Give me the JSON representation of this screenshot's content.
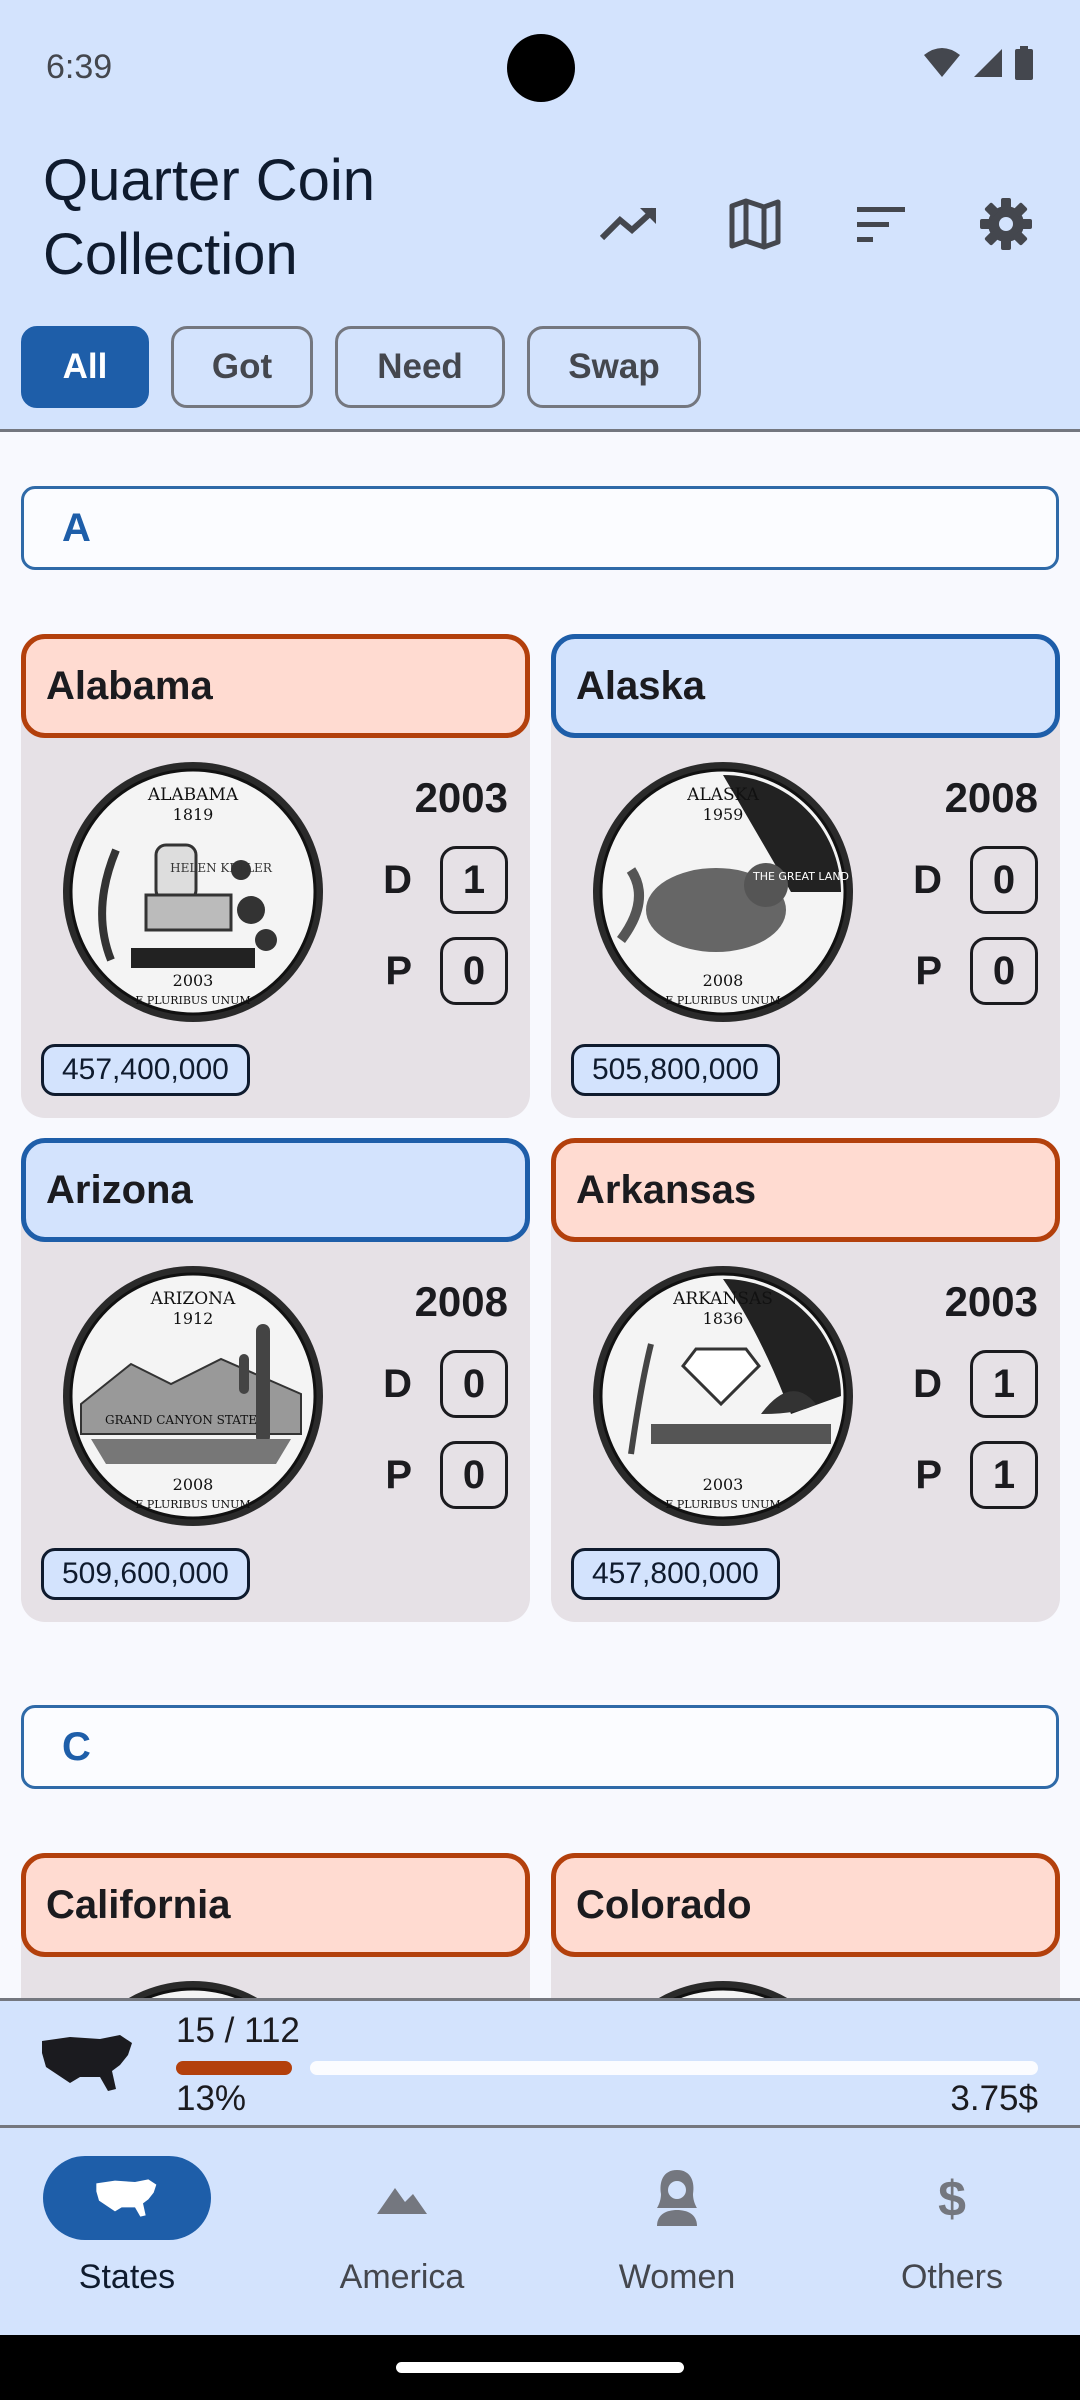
{
  "status_bar": {
    "time": "6:39"
  },
  "app": {
    "title": "Quarter Coin Collection",
    "actions": [
      {
        "icon": "trending-up-icon"
      },
      {
        "icon": "map-icon"
      },
      {
        "icon": "sort-icon"
      },
      {
        "icon": "gear-icon"
      }
    ]
  },
  "filters": [
    {
      "label": "All",
      "active": true
    },
    {
      "label": "Got",
      "active": false
    },
    {
      "label": "Need",
      "active": false
    },
    {
      "label": "Swap",
      "active": false
    }
  ],
  "sections": [
    {
      "letter": "A",
      "coins": [
        {
          "name": "Alabama",
          "status": "need",
          "year": "2003",
          "d_count": "1",
          "p_count": "0",
          "mintage": "457,400,000",
          "coin_text": {
            "top": "ALABAMA",
            "year_top": "1819",
            "mid": "HELEN KELLER",
            "bottom_year": "2003",
            "motto": "E PLURIBUS UNUM"
          }
        },
        {
          "name": "Alaska",
          "status": "got",
          "year": "2008",
          "d_count": "0",
          "p_count": "0",
          "mintage": "505,800,000",
          "coin_text": {
            "top": "ALASKA",
            "year_top": "1959",
            "mid": "THE GREAT LAND",
            "bottom_year": "2008",
            "motto": "E PLURIBUS UNUM"
          }
        },
        {
          "name": "Arizona",
          "status": "got",
          "year": "2008",
          "d_count": "0",
          "p_count": "0",
          "mintage": "509,600,000",
          "coin_text": {
            "top": "ARIZONA",
            "year_top": "1912",
            "mid": "GRAND CANYON STATE",
            "bottom_year": "2008",
            "motto": "E PLURIBUS UNUM"
          }
        },
        {
          "name": "Arkansas",
          "status": "need",
          "year": "2003",
          "d_count": "1",
          "p_count": "1",
          "mintage": "457,800,000",
          "coin_text": {
            "top": "ARKANSAS",
            "year_top": "1836",
            "mid": "",
            "bottom_year": "2003",
            "motto": "E PLURIBUS UNUM"
          }
        }
      ]
    },
    {
      "letter": "C",
      "coins": [
        {
          "name": "California",
          "status": "need"
        },
        {
          "name": "Colorado",
          "status": "need"
        }
      ]
    }
  ],
  "mint_labels": {
    "d": "D",
    "p": "P"
  },
  "progress": {
    "count_text": "15 / 112",
    "percent_text": "13%",
    "fraction": 0.134,
    "value_text": "3.75$"
  },
  "bottom_nav": [
    {
      "label": "States",
      "icon": "us-map-icon",
      "active": true
    },
    {
      "label": "America",
      "icon": "mountain-icon",
      "active": false
    },
    {
      "label": "Women",
      "icon": "woman-icon",
      "active": false
    },
    {
      "label": "Others",
      "icon": "dollar-icon",
      "active": false
    }
  ],
  "colors": {
    "accent": "#1e5ea9",
    "need": "#b3400c",
    "need_bg": "#ffdbd1",
    "got_bg": "#d3e3fd",
    "card_bg": "#e6e1e6"
  }
}
